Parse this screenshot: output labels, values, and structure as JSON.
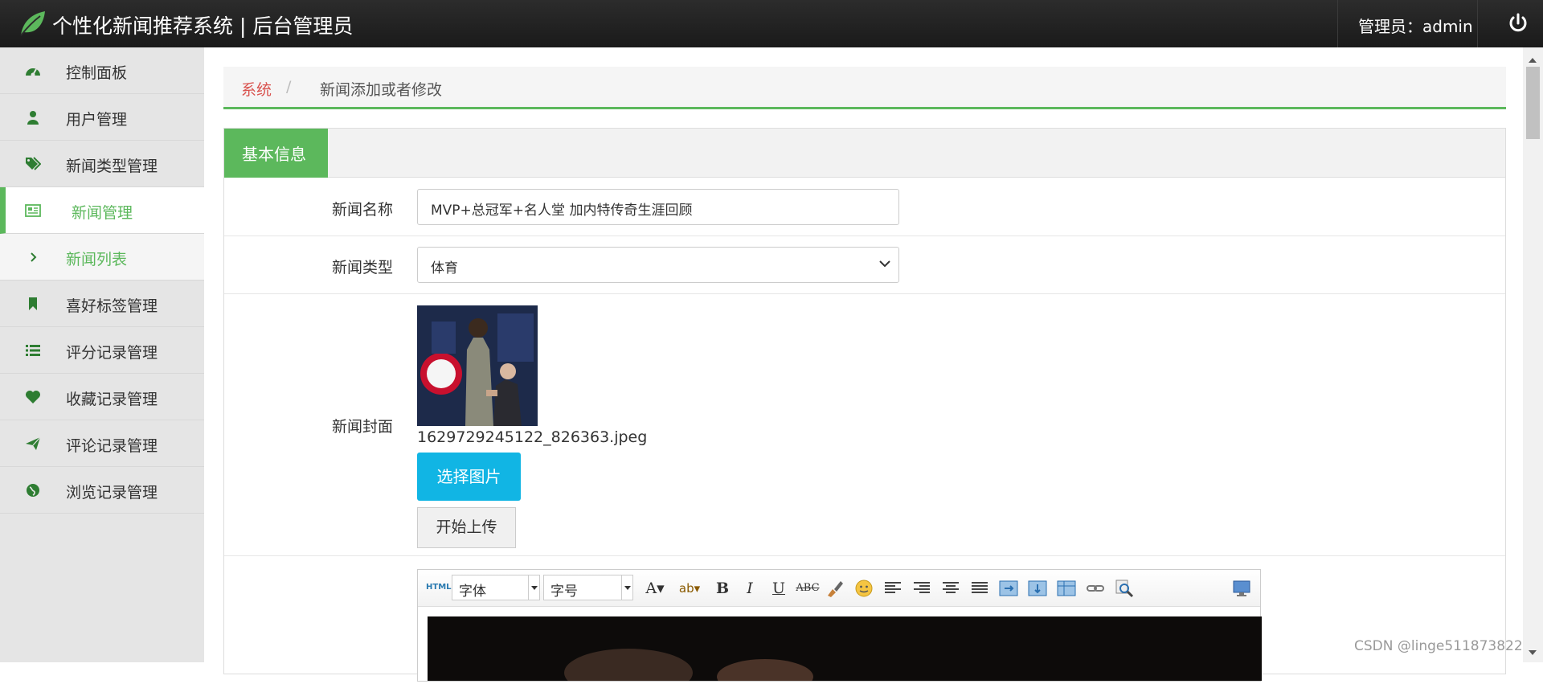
{
  "header": {
    "title": "个性化新闻推荐系统 | 后台管理员",
    "admin_label": "管理员：admin"
  },
  "sidebar": {
    "items": [
      {
        "label": "控制面板",
        "icon": "dashboard-icon"
      },
      {
        "label": "用户管理",
        "icon": "user-icon"
      },
      {
        "label": "新闻类型管理",
        "icon": "tags-icon"
      },
      {
        "label": "新闻管理",
        "icon": "newspaper-icon",
        "active": true
      },
      {
        "label": "新闻列表",
        "icon": "chevron-right-icon",
        "sub": true
      },
      {
        "label": "喜好标签管理",
        "icon": "bookmark-icon"
      },
      {
        "label": "评分记录管理",
        "icon": "list-icon"
      },
      {
        "label": "收藏记录管理",
        "icon": "heart-icon"
      },
      {
        "label": "评论记录管理",
        "icon": "send-icon"
      },
      {
        "label": "浏览记录管理",
        "icon": "globe-icon"
      }
    ]
  },
  "breadcrumb": {
    "root": "系统",
    "separator": "/",
    "current": "新闻添加或者修改"
  },
  "panel": {
    "tab": "基本信息"
  },
  "form": {
    "name_label": "新闻名称",
    "name_value": "MVP+总冠军+名人堂 加内特传奇生涯回顾",
    "type_label": "新闻类型",
    "type_value": "体育",
    "cover_label": "新闻封面",
    "cover_filename": "1629729245122_826363.jpeg",
    "pick_button": "选择图片",
    "upload_button": "开始上传"
  },
  "editor": {
    "html_button": "HTML",
    "font_combo": "字体",
    "size_combo": "字号"
  },
  "watermark": "CSDN @linge511873822",
  "colors": {
    "accent": "#5cb85c",
    "pick_button": "#11b5e4",
    "crumb_link": "#d9534f"
  }
}
